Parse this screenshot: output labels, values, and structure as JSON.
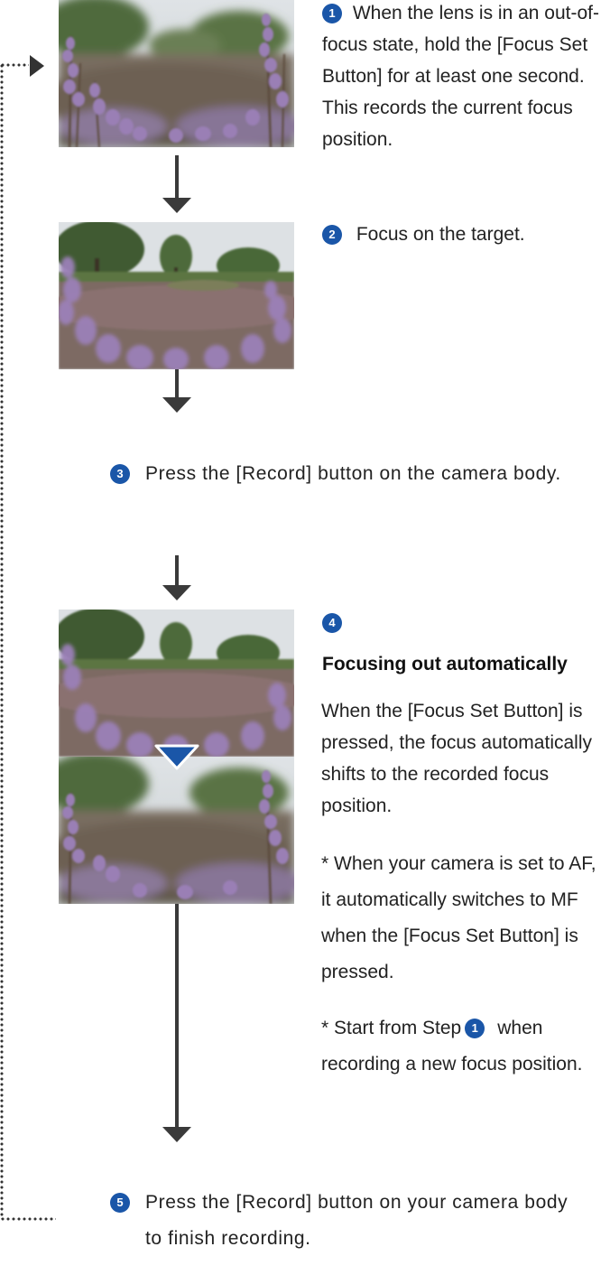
{
  "steps": {
    "step1": {
      "number": "1",
      "text": "When the lens is in an out-of-focus state, hold the [Focus Set Button] for at least one second. This records the current focus position."
    },
    "step2": {
      "number": "2",
      "text": "Focus on the target."
    },
    "step3": {
      "number": "3",
      "text": "Press the [Record] button on the camera body."
    },
    "step4": {
      "number": "4",
      "heading": "Focusing out automatically",
      "text": "When the [Focus Set Button] is pressed, the focus automatically shifts to the recorded focus position.",
      "note1": "* When your camera is set to AF, it automatically switches to MF when the [Focus Set Button] is pressed.",
      "note2_before": "* Start from Step",
      "note2_step": "1",
      "note2_after": "when recording a new focus position."
    },
    "step5": {
      "number": "5",
      "text": "Press the [Record] button on your camera body to finish recording."
    }
  },
  "colors": {
    "badge": "#1a56a8",
    "arrow": "#3a3a3a",
    "text": "#222222"
  }
}
